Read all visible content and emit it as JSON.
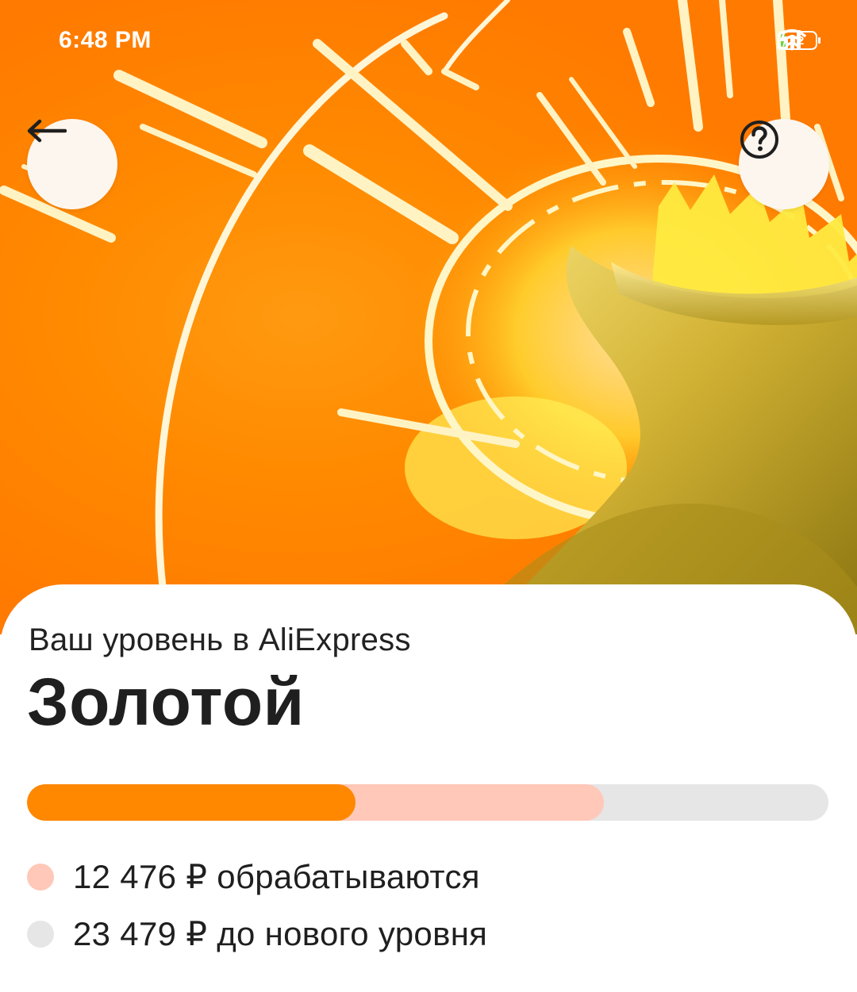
{
  "status_bar": {
    "time": "6:48 PM",
    "battery_level": "12",
    "icons": [
      "signal-icon",
      "signal-icon",
      "wifi-icon",
      "battery-icon",
      "charging-icon"
    ]
  },
  "header": {
    "back_icon": "arrow-left-icon",
    "help_icon": "question-circle-icon"
  },
  "level": {
    "subtitle": "Ваш уровень в AliExpress",
    "name": "Золотой"
  },
  "progress": {
    "done_fraction": 0.41,
    "pending_fraction": 0.72
  },
  "legend": [
    {
      "text": "12 476 ₽ обрабатываются",
      "color": "#ffc8b8"
    },
    {
      "text": "23 479 ₽ до нового уровня",
      "color": "#e6e6e6"
    }
  ],
  "colors": {
    "accent": "#ff8800",
    "pending": "#ffc8b8",
    "remaining": "#e6e6e6"
  }
}
